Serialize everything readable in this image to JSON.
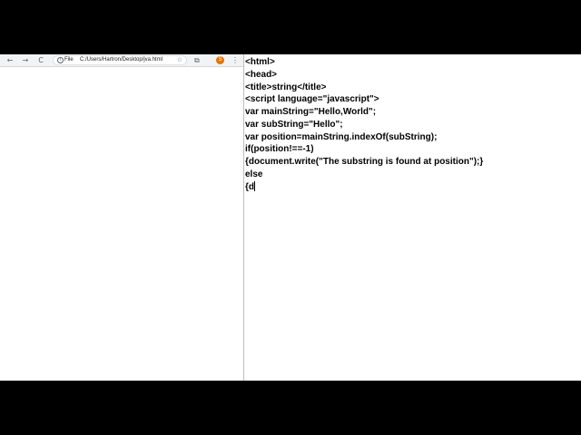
{
  "browser": {
    "nav": {
      "back": "←",
      "forward": "→",
      "reload": "C"
    },
    "address_bar": {
      "scheme_label": "File",
      "url": "C:/Users/Hartron/Desktop/jva.html",
      "info_icon": "i",
      "bookmark_icon": "☆"
    },
    "extensions_icon": "⧉",
    "profile_initial": "S",
    "menu_icon": "⋮"
  },
  "editor": {
    "lines": [
      "<html>",
      "<head>",
      "<title>string</title>",
      "<script language=\"javascript\">",
      "var mainString=\"Hello,World\";",
      "var subString=\"Hello\";",
      "var position=mainString.indexOf(subString);",
      "if(position!==-1)",
      "{document.write(\"The substring is found at position\");}",
      "else",
      "{d"
    ]
  },
  "colors": {
    "background": "#000000",
    "toolbar": "#f1f3f4",
    "profile_badge": "#e37400"
  }
}
